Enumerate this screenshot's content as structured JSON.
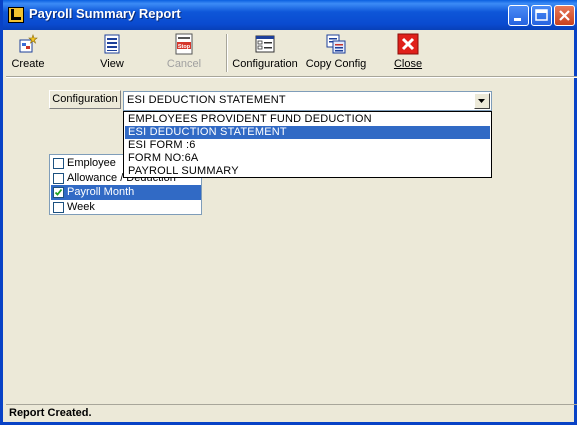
{
  "window": {
    "title": "Payroll Summary Report"
  },
  "toolbar": {
    "create": "Create",
    "view": "View",
    "cancel": "Cancel",
    "cancel_icon_text": "Stop",
    "configuration": "Configuration",
    "copy_config": "Copy Config",
    "close": "Close"
  },
  "config": {
    "label": "Configuration",
    "selected": "ESI DEDUCTION STATEMENT",
    "options": [
      {
        "label": "EMPLOYEES PROVIDENT FUND DEDUCTION",
        "selected": false
      },
      {
        "label": "ESI DEDUCTION STATEMENT",
        "selected": true
      },
      {
        "label": "ESI FORM :6",
        "selected": false
      },
      {
        "label": "FORM NO:6A",
        "selected": false
      },
      {
        "label": "PAYROLL SUMMARY",
        "selected": false
      }
    ]
  },
  "criteria": {
    "items": [
      {
        "label": "Employee",
        "checked": false,
        "selected": false
      },
      {
        "label": "Allowance / Deduction",
        "checked": false,
        "selected": false
      },
      {
        "label": "Payroll Month",
        "checked": true,
        "selected": true
      },
      {
        "label": "Week",
        "checked": false,
        "selected": false
      }
    ]
  },
  "status": {
    "text": "Report Created."
  },
  "colors": {
    "titlebar": "#0A4BD0",
    "selection": "#316AC5",
    "face": "#ECE9D8"
  }
}
